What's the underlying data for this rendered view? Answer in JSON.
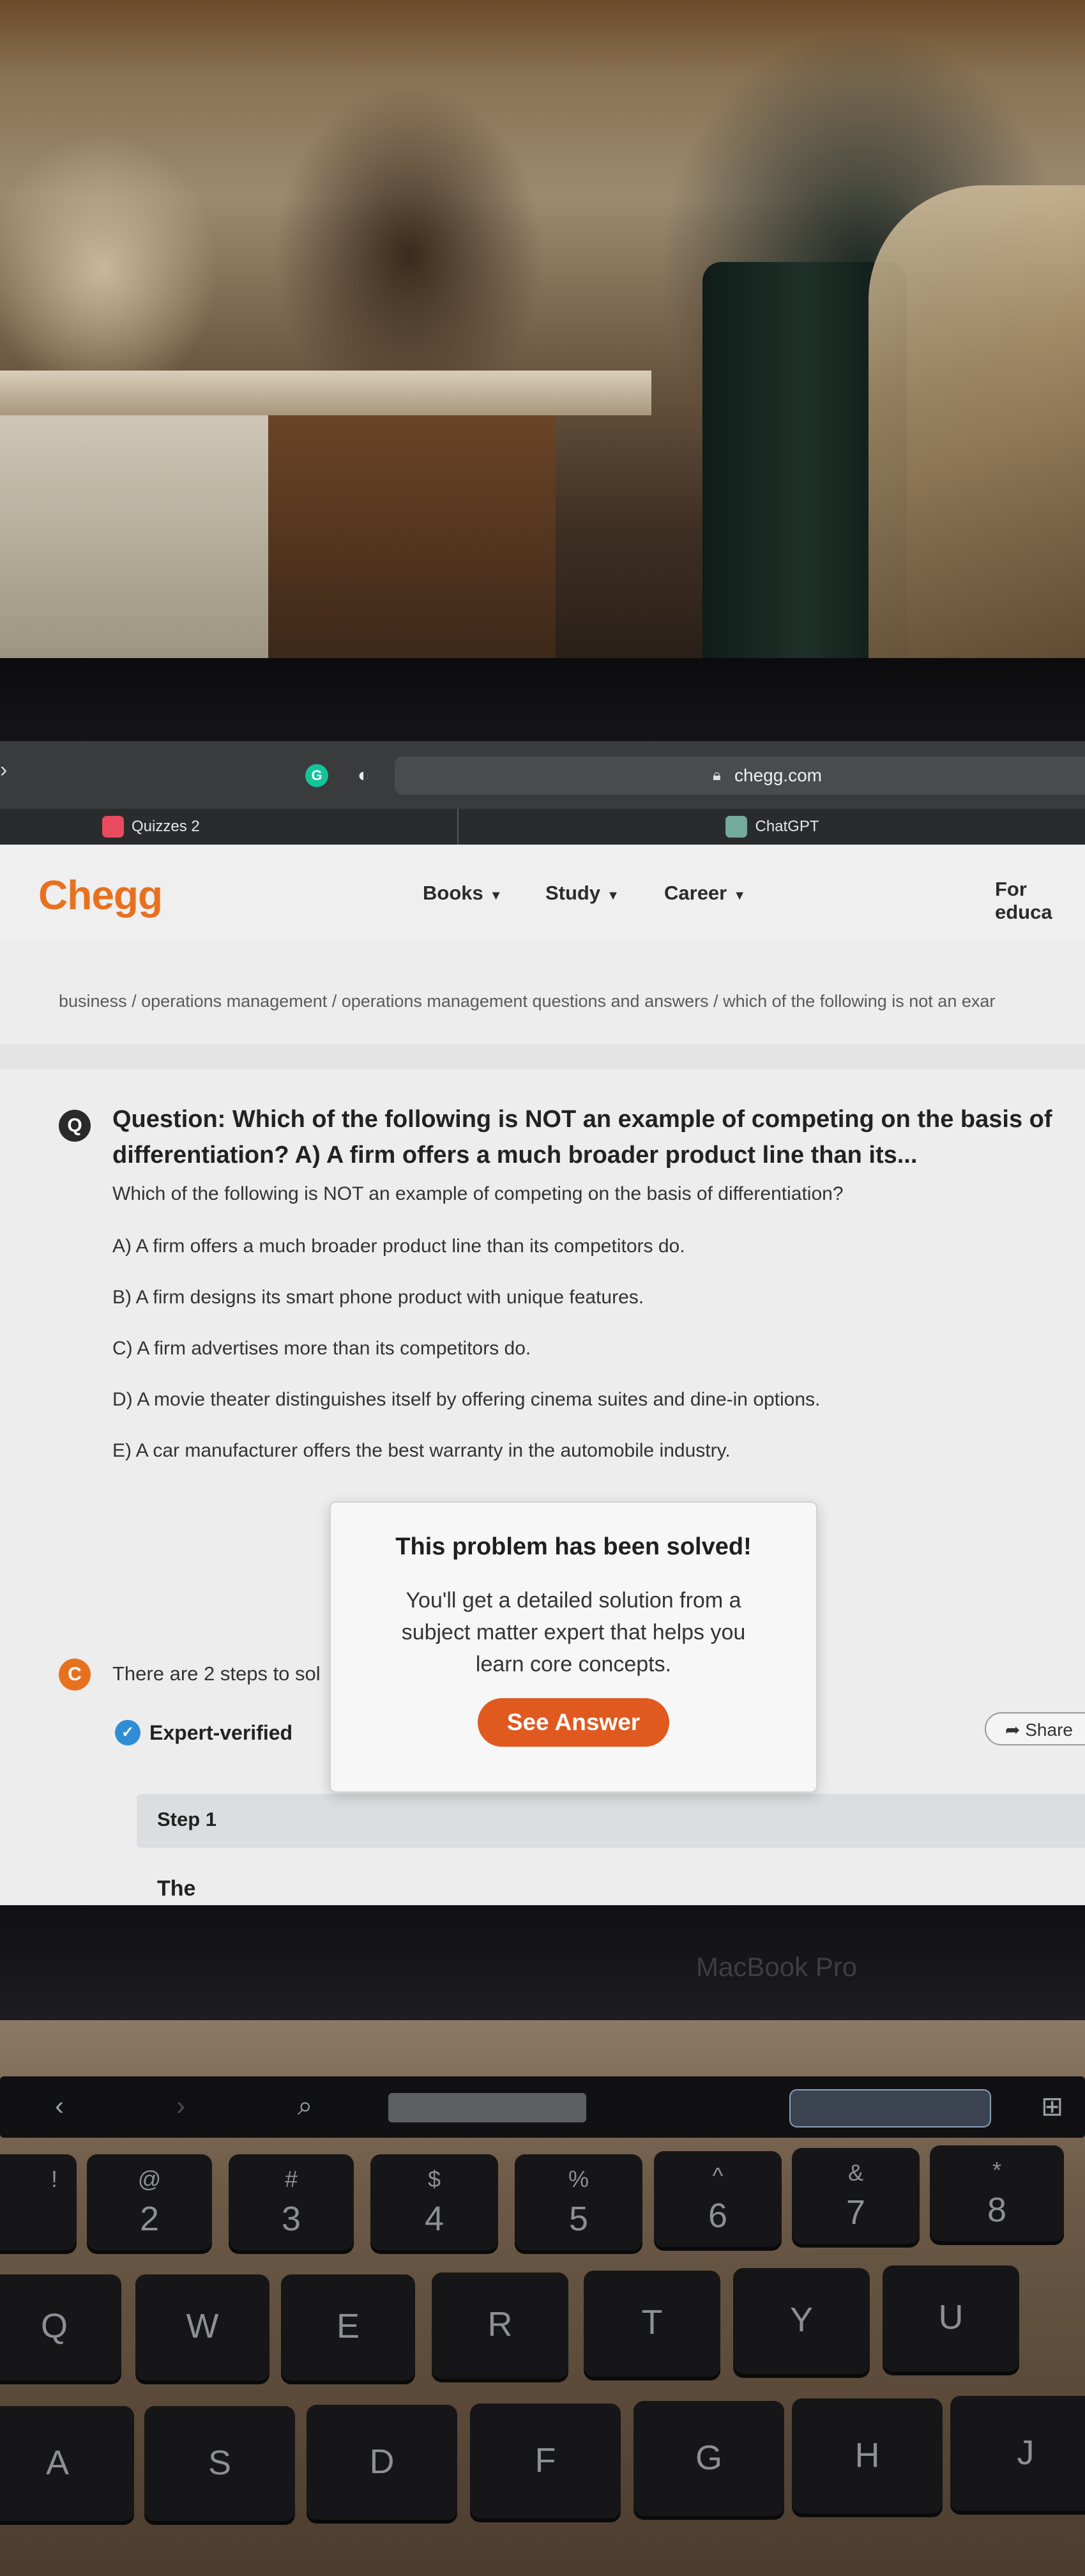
{
  "browser": {
    "url": "chegg.com",
    "tabs": [
      {
        "label": "Quizzes 2"
      },
      {
        "label": "ChatGPT"
      }
    ]
  },
  "header": {
    "logo": "Chegg",
    "nav": [
      {
        "label": "Books"
      },
      {
        "label": "Study"
      },
      {
        "label": "Career"
      }
    ],
    "for_educators": "For educa"
  },
  "breadcrumb": "business / operations management / operations management questions and answers / which of the following is not an exar",
  "question": {
    "title": "Question: Which of the following is NOT an example of competing on the basis of differentiation? A) A firm offers a much broader product line than its...",
    "prompt": "Which of the following is NOT an example of competing on the basis of differentiation?",
    "options": [
      "A) A firm offers a much broader product line than its competitors do.",
      "B) A firm designs its smart phone product with unique features.",
      "C) A firm advertises more than its competitors do.",
      "D) A movie theater distinguishes itself by offering cinema suites and dine-in options.",
      "E) A car manufacturer offers the best warranty in the automobile industry."
    ]
  },
  "answer": {
    "steps_text": "There are 2 steps to sol",
    "verified_label": "Expert-verified",
    "share_label": "Share",
    "step1_label": "Step 1",
    "step_text": "The"
  },
  "modal": {
    "title": "This problem has been solved!",
    "body": "You'll get a detailed solution from a subject matter expert that helps you learn core concepts.",
    "button": "See Answer"
  },
  "device": {
    "label": "MacBook Pro"
  },
  "keyboard": {
    "number_row": [
      {
        "top": "!",
        "main": ""
      },
      {
        "top": "@",
        "main": "2"
      },
      {
        "top": "#",
        "main": "3"
      },
      {
        "top": "$",
        "main": "4"
      },
      {
        "top": "%",
        "main": "5"
      },
      {
        "top": "^",
        "main": "6"
      },
      {
        "top": "&",
        "main": "7"
      },
      {
        "top": "*",
        "main": "8"
      }
    ],
    "row_q": [
      "Q",
      "W",
      "E",
      "R",
      "T",
      "Y",
      "U"
    ],
    "row_a": [
      "A",
      "S",
      "D",
      "F",
      "G",
      "H",
      "J"
    ]
  },
  "colors": {
    "chegg_orange": "#e8711f",
    "see_answer": "#e0591f",
    "verified_blue": "#2f8dd6"
  }
}
